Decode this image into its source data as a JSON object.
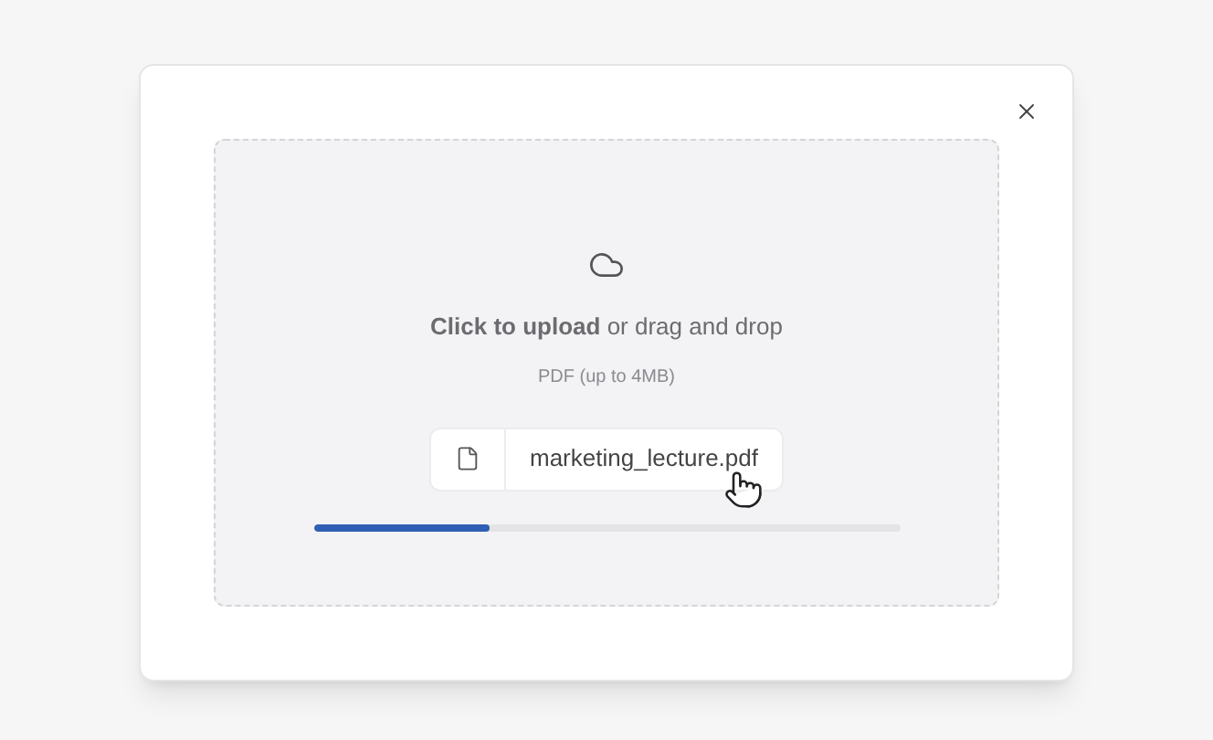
{
  "dialog": {
    "dropzone": {
      "prompt": "**Click to upload** or drag and drop",
      "hint": "PDF (up to 4MB)",
      "file": {
        "name": "marketing_lecture.pdf"
      },
      "progress": {
        "level": 0.3
      }
    }
  }
}
